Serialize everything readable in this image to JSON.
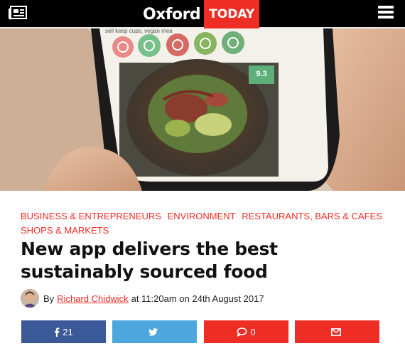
{
  "header": {
    "logo_primary": "Oxford",
    "logo_secondary": "TODAY",
    "left_icon": "newspaper-icon",
    "right_icon": "hamburger-menu-icon",
    "background_color": "#000000",
    "accent_color": "#ee2d24"
  },
  "hero": {
    "screen_caption": "sell keep cups, vegan mea",
    "rating_badge": "9.3"
  },
  "article": {
    "categories": [
      "BUSINESS & ENTREPRENEURS",
      "ENVIRONMENT",
      "RESTAURANTS, BARS & CAFES",
      "SHOPS & MARKETS"
    ],
    "title": "New app delivers the best sustainably sourced food",
    "byline": {
      "prefix": "By",
      "author": "Richard Chidwick",
      "date_text": "at 11:20am on 24th August 2017"
    }
  },
  "share_bar": {
    "facebook": {
      "icon": "facebook-icon",
      "count": "21",
      "color": "#3b5998"
    },
    "twitter": {
      "icon": "twitter-icon",
      "color": "#4da7de"
    },
    "comments": {
      "icon": "comment-icon",
      "count": "0",
      "color": "#ee2d24"
    },
    "email": {
      "icon": "envelope-icon",
      "color": "#ee2d24"
    }
  }
}
